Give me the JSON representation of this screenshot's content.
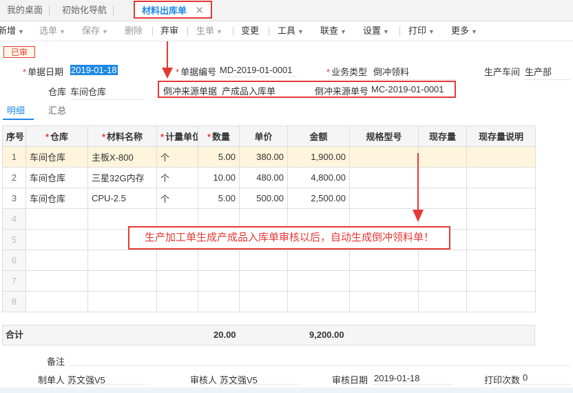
{
  "tabs": [
    {
      "label": "我的桌面"
    },
    {
      "label": "初始化导航"
    },
    {
      "label": "材料出库单",
      "close": "✕"
    }
  ],
  "toolbar": {
    "new": "新增",
    "select": "选单",
    "save": "保存",
    "delete": "删除",
    "discard": "弃审",
    "generate": "生单",
    "change": "变更",
    "tools": "工具",
    "query": "联查",
    "settings": "设置",
    "print": "打印",
    "more": "更多"
  },
  "status_stamp": "已审",
  "header": {
    "date_label": "单据日期",
    "date_value": "2019-01-18",
    "code_label": "单据编号",
    "code_value": "MD-2019-01-0001",
    "biz_label": "业务类型",
    "biz_value": "倒冲领料",
    "workshop_label": "生产车间",
    "workshop_value": "生产部",
    "warehouse_label": "仓库",
    "warehouse_value": "车间仓库",
    "src_doc_label": "倒冲来源单据",
    "src_doc_value": "产成品入库单",
    "src_no_label": "倒冲来源单号",
    "src_no_value": "MC-2019-01-0001"
  },
  "subtabs": {
    "detail": "明细",
    "summary": "汇总"
  },
  "table": {
    "headers": [
      "序号",
      "仓库",
      "材料名称",
      "计量单位",
      "数量",
      "单价",
      "金额",
      "规格型号",
      "现存量",
      "现存量说明"
    ],
    "rows": [
      {
        "no": "1",
        "wh": "车间仓库",
        "name": "主板X-800",
        "unit": "个",
        "qty": "5.00",
        "price": "380.00",
        "amount": "1,900.00"
      },
      {
        "no": "2",
        "wh": "车间仓库",
        "name": "三星32G内存",
        "unit": "个",
        "qty": "10.00",
        "price": "480.00",
        "amount": "4,800.00"
      },
      {
        "no": "3",
        "wh": "车间仓库",
        "name": "CPU-2.5",
        "unit": "个",
        "qty": "5.00",
        "price": "500.00",
        "amount": "2,500.00"
      }
    ],
    "empty_rows": [
      "4",
      "5",
      "6",
      "7",
      "8"
    ]
  },
  "totals": {
    "label": "合计",
    "qty": "20.00",
    "amount": "9,200.00"
  },
  "annotation": "生产加工单生成产成品入库单审核以后，自动生成倒冲领料单！",
  "footer": {
    "remark_label": "备注",
    "maker_label": "制单人",
    "maker_value": "苏文强V5",
    "auditor_label": "审核人",
    "auditor_value": "苏文强V5",
    "audit_date_label": "审核日期",
    "audit_date_value": "2019-01-18",
    "print_count_label": "打印次数",
    "print_count_value": "0"
  },
  "colors": {
    "accent": "#1e88e5",
    "annotation_red": "#e53935",
    "highlight_row": "#fff4dc"
  }
}
